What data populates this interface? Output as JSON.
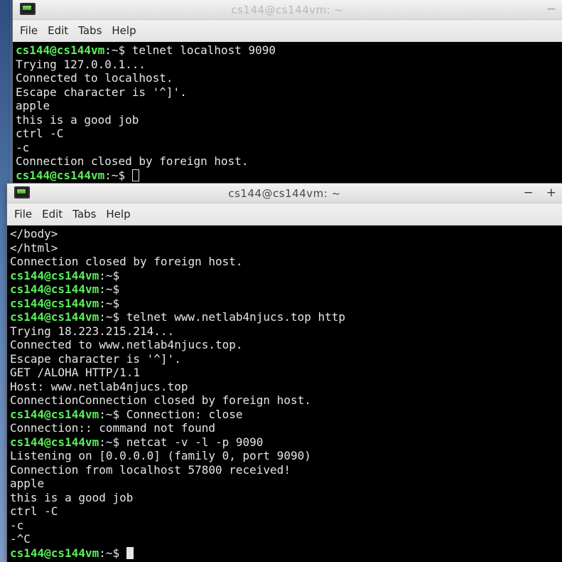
{
  "menu": {
    "file": "File",
    "edit": "Edit",
    "tabs": "Tabs",
    "help": "Help"
  },
  "window_controls": {
    "minimize": "−",
    "maximize": "+"
  },
  "prompt": {
    "user": "cs144@cs144vm",
    "sep": ":~$ "
  },
  "window1": {
    "title": "cs144@cs144vm: ~",
    "lines": [
      {
        "prompt": true,
        "text": "telnet localhost 9090"
      },
      {
        "prompt": false,
        "text": "Trying 127.0.0.1..."
      },
      {
        "prompt": false,
        "text": "Connected to localhost."
      },
      {
        "prompt": false,
        "text": "Escape character is '^]'."
      },
      {
        "prompt": false,
        "text": "apple"
      },
      {
        "prompt": false,
        "text": "this is a good job"
      },
      {
        "prompt": false,
        "text": "ctrl -C"
      },
      {
        "prompt": false,
        "text": "-c"
      },
      {
        "prompt": false,
        "text": "Connection closed by foreign host."
      },
      {
        "prompt": true,
        "text": "",
        "cursor": "hollow"
      }
    ]
  },
  "window2": {
    "title": "cs144@cs144vm: ~",
    "lines": [
      {
        "prompt": false,
        "text": "</body>"
      },
      {
        "prompt": false,
        "text": "</html>"
      },
      {
        "prompt": false,
        "text": "Connection closed by foreign host."
      },
      {
        "prompt": true,
        "text": ""
      },
      {
        "prompt": true,
        "text": ""
      },
      {
        "prompt": true,
        "text": ""
      },
      {
        "prompt": true,
        "text": "telnet www.netlab4njucs.top http"
      },
      {
        "prompt": false,
        "text": "Trying 18.223.215.214..."
      },
      {
        "prompt": false,
        "text": "Connected to www.netlab4njucs.top."
      },
      {
        "prompt": false,
        "text": "Escape character is '^]'."
      },
      {
        "prompt": false,
        "text": "GET /ALOHA HTTP/1.1"
      },
      {
        "prompt": false,
        "text": "Host: www.netlab4njucs.top"
      },
      {
        "prompt": false,
        "text": "ConnectionConnection closed by foreign host."
      },
      {
        "prompt": true,
        "text": "Connection: close"
      },
      {
        "prompt": false,
        "text": "Connection:: command not found"
      },
      {
        "prompt": true,
        "text": "netcat -v -l -p 9090"
      },
      {
        "prompt": false,
        "text": "Listening on [0.0.0.0] (family 0, port 9090)"
      },
      {
        "prompt": false,
        "text": "Connection from localhost 57800 received!"
      },
      {
        "prompt": false,
        "text": "apple"
      },
      {
        "prompt": false,
        "text": "this is a good job"
      },
      {
        "prompt": false,
        "text": "ctrl -C"
      },
      {
        "prompt": false,
        "text": "-c"
      },
      {
        "prompt": false,
        "text": "-^C"
      },
      {
        "prompt": true,
        "text": "",
        "cursor": "solid"
      }
    ]
  }
}
